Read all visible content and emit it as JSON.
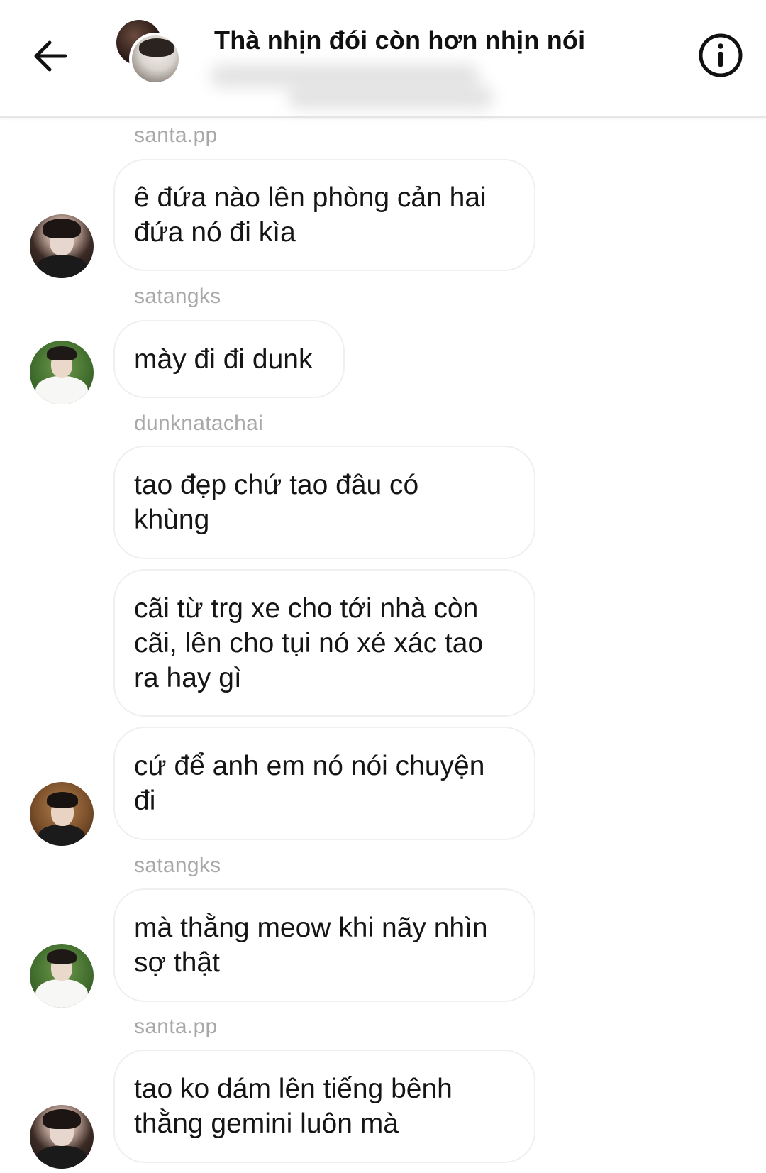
{
  "header": {
    "title": "Thà nhịn đói còn hơn nhịn nói",
    "back_icon": "arrow-left-icon",
    "info_icon": "info-circle-icon"
  },
  "messages": [
    {
      "sender": "santa.pp",
      "text": [
        "ê đứa nào lên phòng cản hai",
        "đứa nó đi kìa"
      ]
    },
    {
      "sender": "satangks",
      "text": [
        "mày đi đi dunk"
      ]
    },
    {
      "sender": "dunknatachai",
      "text": [
        "tao đẹp chứ tao đâu có",
        "khùng"
      ]
    },
    {
      "sender": "",
      "text": [
        "cãi từ trg xe cho tới nhà còn",
        "cãi, lên cho tụi nó xé xác tao",
        "ra hay gì"
      ]
    },
    {
      "sender": "",
      "text": [
        "cứ để anh em nó nói chuyện",
        "đi"
      ]
    },
    {
      "sender": "satangks",
      "text": [
        "mà thằng meow khi nãy nhìn",
        "sợ thật"
      ]
    },
    {
      "sender": "santa.pp",
      "text": [
        "tao ko dám lên tiếng bênh",
        "thằng gemini luôn mà"
      ]
    }
  ]
}
